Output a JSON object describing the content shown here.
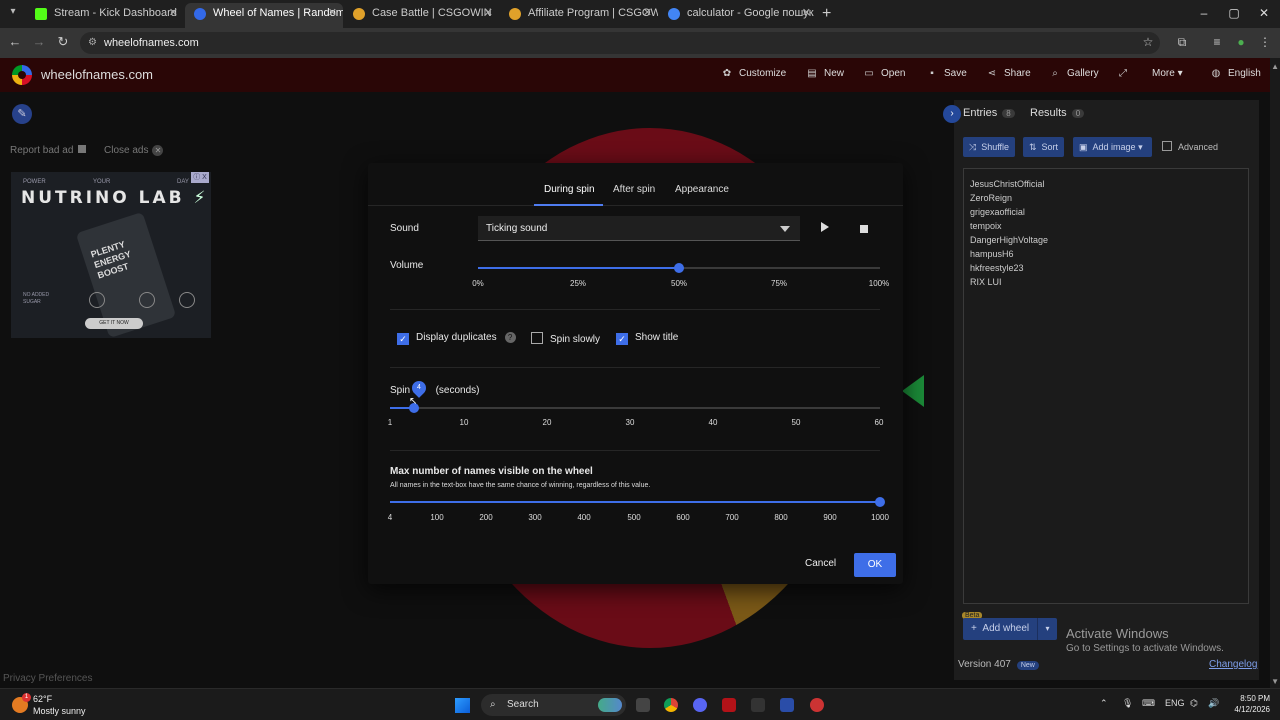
{
  "browser": {
    "tabs": [
      {
        "title": "Stream - Kick Dashboard",
        "favicon_color": "#53fc18",
        "active": false
      },
      {
        "title": "Wheel of Names | Random nam",
        "favicon_color": "#3369e8",
        "active": true
      },
      {
        "title": "Case Battle | CSGOWIN",
        "favicon_color": "#e0a12a",
        "active": false
      },
      {
        "title": "Affiliate Program | CSGOWIN | ",
        "favicon_color": "#e0a12a",
        "active": false
      },
      {
        "title": "calculator - Google пошук",
        "favicon_color": "#4285f4",
        "active": false
      }
    ],
    "url": "wheelofnames.com"
  },
  "site": {
    "name": "wheelofnames.com",
    "nav": {
      "customize": "Customize",
      "new": "New",
      "open": "Open",
      "save": "Save",
      "share": "Share",
      "gallery": "Gallery",
      "more": "More",
      "language": "English"
    },
    "report_ad": "Report bad ad",
    "close_ads": "Close ads",
    "privacy": "Privacy Preferences"
  },
  "ad": {
    "tagline_words": [
      "POWER",
      "YOUR",
      "DAY"
    ],
    "brand": "NUTRINO LAB",
    "can_text": "PLENTY ENERGY BOOST",
    "sugar": "NO ADDED SUGAR",
    "cta": "GET IT NOW",
    "badge": "ⓘ X"
  },
  "dialog": {
    "tabs": [
      "During spin",
      "After spin",
      "Appearance"
    ],
    "active_tab": "During spin",
    "sound_label": "Sound",
    "sound_value": "Ticking sound",
    "volume_label": "Volume",
    "volume_value": 0.5,
    "volume_ticks": [
      "0%",
      "25%",
      "50%",
      "75%",
      "100%"
    ],
    "checks": {
      "display_duplicates": {
        "label": "Display duplicates",
        "checked": true
      },
      "spin_slowly": {
        "label": "Spin slowly",
        "checked": false
      },
      "show_title": {
        "label": "Show title",
        "checked": true
      }
    },
    "spin_time_label_a": "Spin t",
    "spin_time_label_b": "(seconds)",
    "spin_time_value": "4",
    "spin_time_ticks": [
      "1",
      "10",
      "20",
      "30",
      "40",
      "50",
      "60"
    ],
    "max_names_label": "Max number of names visible on the wheel",
    "max_names_note": "All names in the text-box have the same chance of winning, regardless of this value.",
    "max_names_value": 1000,
    "max_names_ticks": [
      "4",
      "100",
      "200",
      "300",
      "400",
      "500",
      "600",
      "700",
      "800",
      "900",
      "1000"
    ],
    "cancel": "Cancel",
    "ok": "OK"
  },
  "panel": {
    "entries_tab": "Entries",
    "entries_count": "8",
    "results_tab": "Results",
    "results_count": "0",
    "shuffle": "Shuffle",
    "sort": "Sort",
    "add_image": "Add image",
    "advanced": "Advanced",
    "entries": [
      "JesusChristOfficial",
      "ZeroReign",
      "grigexaofficial",
      "tempoix",
      "DangerHighVoltage",
      "hampusH6",
      "hkfreestyle23",
      "RIX LUI"
    ],
    "beta": "Beta",
    "add_wheel": "Add wheel",
    "version": "Version 407",
    "new_badge": "New",
    "changelog": "Changelog"
  },
  "windows": {
    "activate_title": "Activate Windows",
    "activate_sub": "Go to Settings to activate Windows.",
    "temperature": "62°F",
    "condition": "Mostly sunny",
    "search": "Search",
    "lang": "ENG",
    "time": "8:50 PM",
    "date": "4/12/2026"
  }
}
